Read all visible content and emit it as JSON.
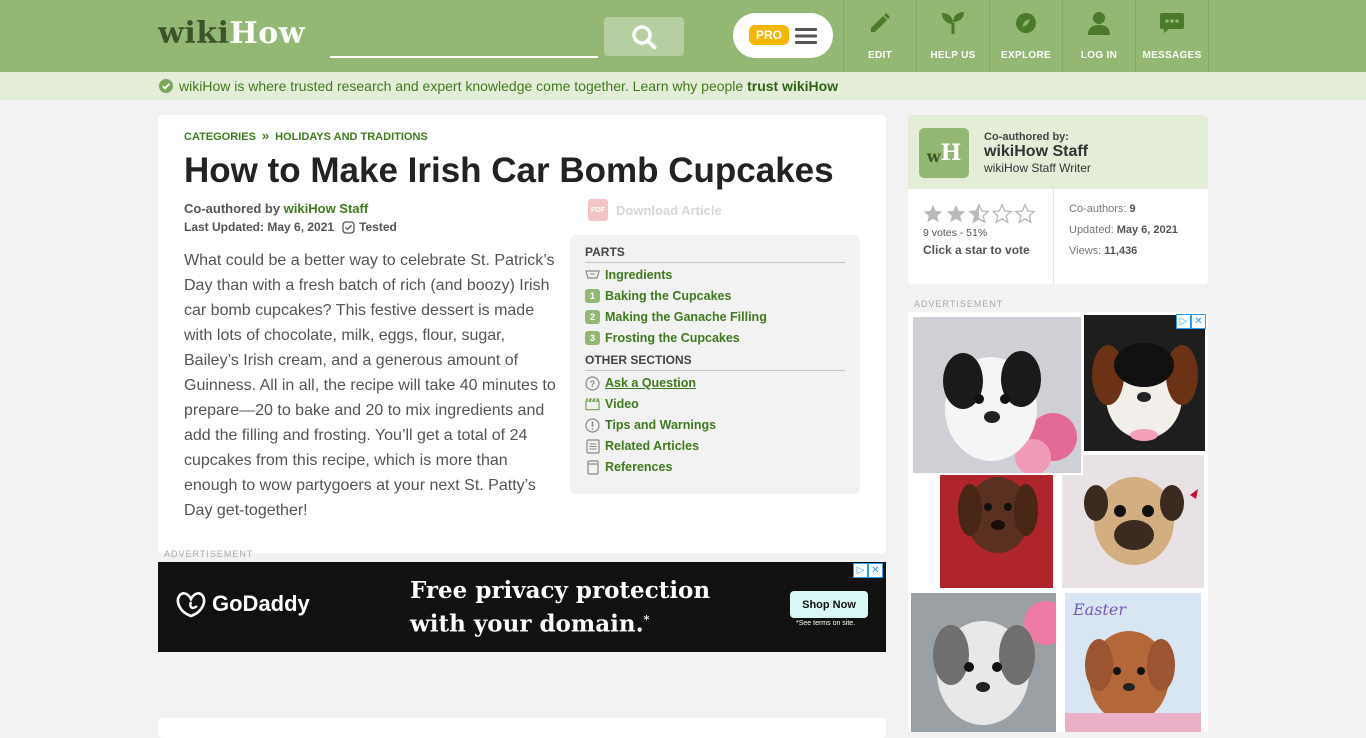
{
  "header": {
    "logo_wiki": "wiki",
    "logo_how": "How",
    "search_placeholder": "",
    "pro_label": "PRO",
    "nav": [
      {
        "label": "EDIT",
        "icon": "pencil-icon"
      },
      {
        "label": "HELP US",
        "icon": "sprout-icon"
      },
      {
        "label": "EXPLORE",
        "icon": "compass-icon"
      },
      {
        "label": "LOG IN",
        "icon": "user-icon"
      },
      {
        "label": "MESSAGES",
        "icon": "chat-icon"
      }
    ]
  },
  "banner": {
    "text": "wikiHow is where trusted research and expert knowledge come together. Learn why people ",
    "link": "trust wikiHow"
  },
  "article": {
    "breadcrumbs": [
      "CATEGORIES",
      "HOLIDAYS AND TRADITIONS"
    ],
    "breadcrumb_separator": "»",
    "title": "How to Make Irish Car Bomb Cupcakes",
    "coauthored_label": "Co-authored by ",
    "author": "wikiHow Staff",
    "updated": "Last Updated: May 6, 2021",
    "tested": "Tested",
    "download": "Download Article",
    "intro": "What could be a better way to celebrate St. Patrick’s Day than with a fresh batch of rich (and boozy) Irish car bomb cupcakes? This festive dessert is made with lots of chocolate, milk, eggs, flour, sugar, Bailey’s Irish cream, and a generous amount of Guinness. All in all, the recipe will take 40 minutes to prepare—20 to bake and 20 to mix ingredients and add the filling and frosting. You’ll get a total of 24 cupcakes from this recipe, which is more than enough to wow partygoers at your next St. Patty’s Day get-together!"
  },
  "toc": {
    "parts_heading": "PARTS",
    "parts": [
      {
        "num": "",
        "label": "Ingredients",
        "icon": "ingredients-icon"
      },
      {
        "num": "1",
        "label": "Baking the Cupcakes"
      },
      {
        "num": "2",
        "label": "Making the Ganache Filling"
      },
      {
        "num": "3",
        "label": "Frosting the Cupcakes"
      }
    ],
    "other_heading": "OTHER SECTIONS",
    "other": [
      {
        "label": "Ask a Question",
        "icon": "question-icon"
      },
      {
        "label": "Video",
        "icon": "video-icon"
      },
      {
        "label": "Tips and Warnings",
        "icon": "warning-icon"
      },
      {
        "label": "Related Articles",
        "icon": "document-icon"
      },
      {
        "label": "References",
        "icon": "book-icon"
      }
    ]
  },
  "ads": {
    "label": "ADVERTISEMENT",
    "godaddy": {
      "brand": "GoDaddy",
      "line1": "Free privacy protection",
      "line2": "with your domain.",
      "mark": "*",
      "button": "Shop Now",
      "terms": "*See terms on site."
    }
  },
  "sidebar": {
    "logo_w": "w",
    "logo_h": "H",
    "coauthored_label": "Co-authored by:",
    "name": "wikiHow Staff",
    "role": "wikiHow Staff Writer",
    "rating": 2.5,
    "votes": "9 votes - 51%",
    "vote_cta": "Click a star to vote",
    "coauthors_label": "Co-authors: ",
    "coauthors": "9",
    "updated_label": "Updated: ",
    "updated": "May 6, 2021",
    "views_label": "Views: ",
    "views": "11,436"
  },
  "colors": {
    "brand_green": "#93b874",
    "link_green": "#3f7a1e",
    "pro_yellow": "#f5b700",
    "banner_bg": "#e3edd8"
  }
}
